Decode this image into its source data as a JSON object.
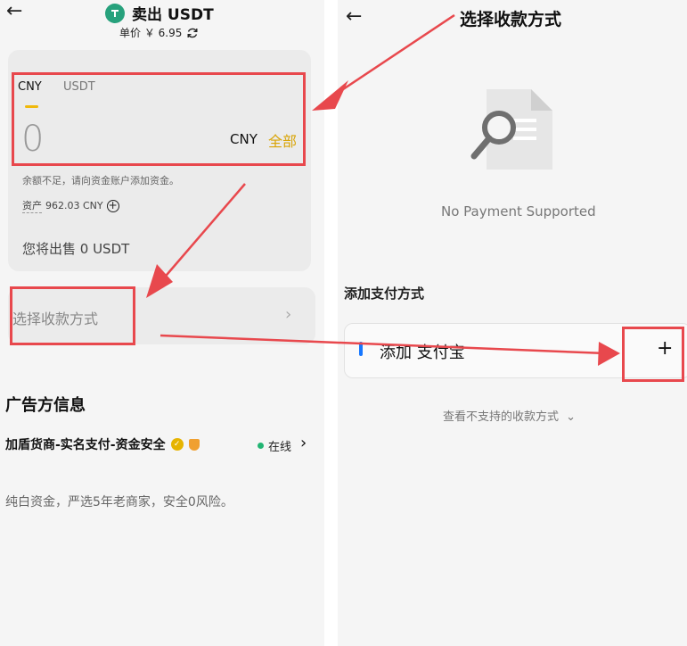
{
  "left": {
    "title": "卖出 USDT",
    "price": "单价 ￥ 6.95",
    "tabs": [
      "CNY",
      "USDT"
    ],
    "amount": "0",
    "unit": "CNY",
    "all_button": "全部",
    "note": "余额不足，请向资金账户添加资金。",
    "asset_label": "资产",
    "asset_value": "962.03 CNY",
    "receive": "您将出售 0 USDT",
    "payment_method": "选择收款方式",
    "advertiser_title": "广告方信息",
    "merchant_name": "加盾货商-实名支付-资金安全",
    "online": "在线",
    "description": "纯白资金，严选5年老商家，安全0风险。"
  },
  "right": {
    "title": "选择收款方式",
    "empty_text": "No Payment Supported",
    "add_title": "添加支付方式",
    "add_item": "添加 支付宝",
    "add_plus": "+",
    "unsupported": "查看不支持的收款方式"
  },
  "icons": {
    "back": "left-arrow-icon",
    "coin": "usdt-coin-icon",
    "refresh": "refresh-icon",
    "search_doc": "document-search-icon"
  },
  "colors": {
    "accent_gold": "#d9a406",
    "annotation_red": "#e8484d",
    "online_green": "#22b573",
    "usdt_green": "#27a17c"
  }
}
